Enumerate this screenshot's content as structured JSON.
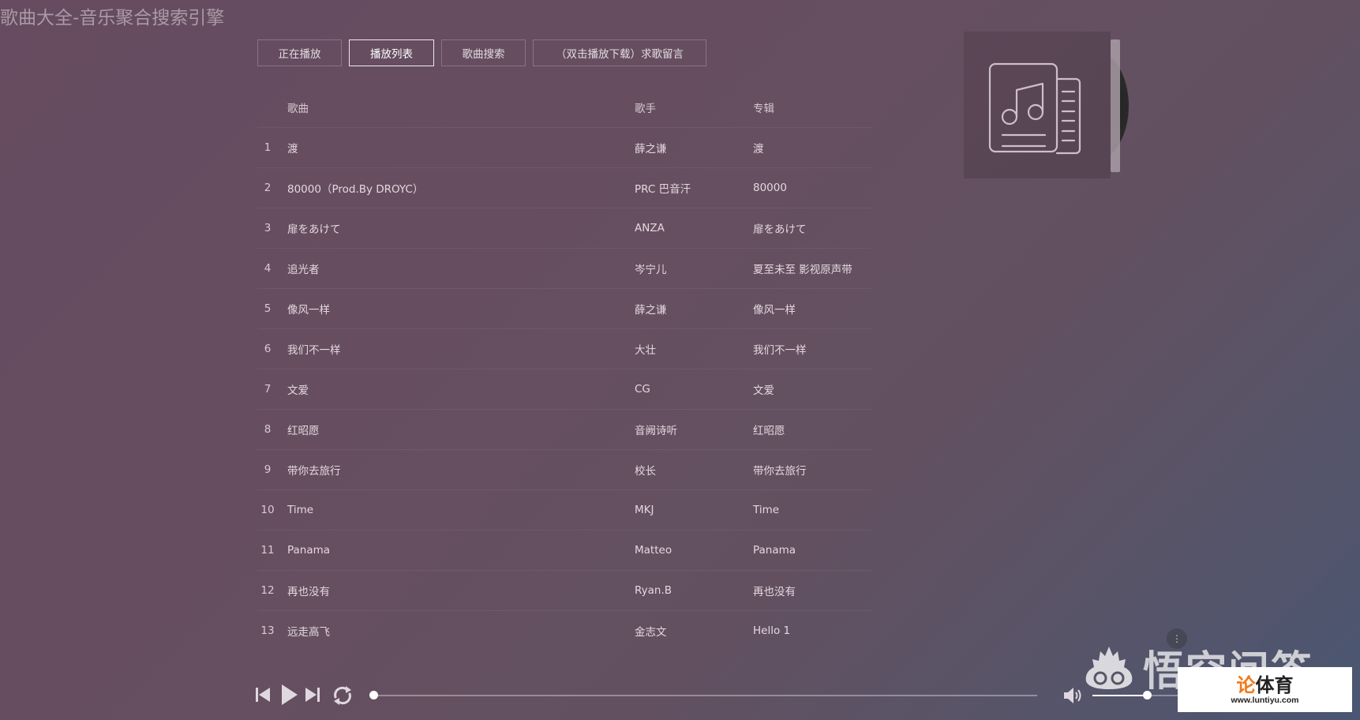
{
  "app": {
    "title": "歌曲大全-音乐聚合搜索引擎"
  },
  "tabs": [
    {
      "label": "正在播放",
      "active": false
    },
    {
      "label": "播放列表",
      "active": true
    },
    {
      "label": "歌曲搜索",
      "active": false
    },
    {
      "label": "（双击播放下载）求歌留言",
      "active": false
    }
  ],
  "playlist": {
    "columns": {
      "index": "",
      "song": "歌曲",
      "singer": "歌手",
      "album": "专辑"
    },
    "rows": [
      {
        "index": "1",
        "song": "渡",
        "singer": "薛之谦",
        "album": "渡"
      },
      {
        "index": "2",
        "song": "80000（Prod.By DROYC）",
        "singer": "PRC 巴音汗",
        "album": "80000"
      },
      {
        "index": "3",
        "song": "扉をあけて",
        "singer": "ANZA",
        "album": "扉をあけて"
      },
      {
        "index": "4",
        "song": "追光者",
        "singer": "岑宁儿",
        "album": "夏至未至 影视原声带"
      },
      {
        "index": "5",
        "song": "像风一样",
        "singer": "薛之谦",
        "album": "像风一样"
      },
      {
        "index": "6",
        "song": "我们不一样",
        "singer": "大壮",
        "album": "我们不一样"
      },
      {
        "index": "7",
        "song": "文爱",
        "singer": "CG",
        "album": "文爱"
      },
      {
        "index": "8",
        "song": "红昭愿",
        "singer": "音阙诗听",
        "album": "红昭愿"
      },
      {
        "index": "9",
        "song": "带你去旅行",
        "singer": "校长",
        "album": "带你去旅行"
      },
      {
        "index": "10",
        "song": "Time",
        "singer": "MKJ",
        "album": "Time"
      },
      {
        "index": "11",
        "song": "Panama",
        "singer": "Matteo",
        "album": "Panama"
      },
      {
        "index": "12",
        "song": "再也没有",
        "singer": "Ryan.B",
        "album": "再也没有"
      },
      {
        "index": "13",
        "song": "远走高飞",
        "singer": "金志文",
        "album": "Hello 1"
      }
    ]
  },
  "cover": {
    "icon": "music-playlist-icon"
  },
  "player": {
    "icons": {
      "prev": "skip-previous-icon",
      "play": "play-icon",
      "next": "skip-next-icon",
      "loop": "repeat-icon",
      "volume": "volume-icon"
    },
    "progress_fraction": 0.0,
    "volume_fraction": 0.5
  },
  "watermarks": {
    "logo_text": "悟空问答",
    "more_glyph": "⋮",
    "badge_main_accent": "论",
    "badge_main_rest": "体育",
    "badge_url": "www.luntiyu.com"
  },
  "colors": {
    "background_start": "#674b60",
    "background_end": "#4a5672",
    "badge_accent": "#f07a1a"
  }
}
